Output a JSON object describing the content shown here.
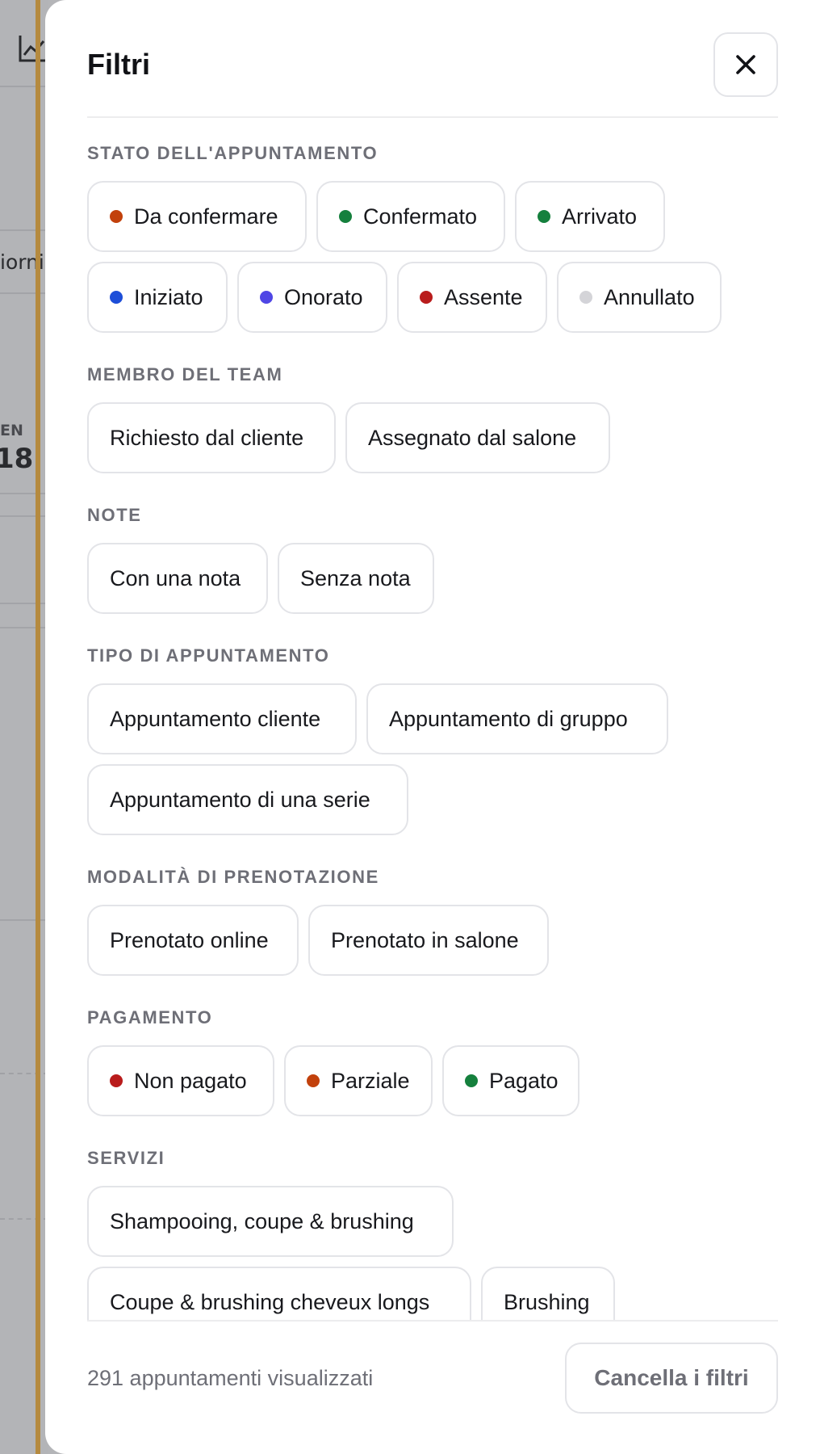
{
  "background": {
    "fragment_1": "iorni",
    "fragment_2": "EN",
    "fragment_3": "18"
  },
  "drawer": {
    "title": "Filtri",
    "close_icon": "close-icon"
  },
  "sections": {
    "status": {
      "label": "STATO DELL'APPUNTAMENTO",
      "chips": [
        {
          "label": "Da confermare",
          "color": "#c2410c"
        },
        {
          "label": "Confermato",
          "color": "#15803d"
        },
        {
          "label": "Arrivato",
          "color": "#15803d"
        },
        {
          "label": "Iniziato",
          "color": "#1d4ed8"
        },
        {
          "label": "Onorato",
          "color": "#4f46e5"
        },
        {
          "label": "Assente",
          "color": "#b91c1c"
        },
        {
          "label": "Annullato",
          "color": "#d4d4d8"
        }
      ]
    },
    "team": {
      "label": "MEMBRO DEL TEAM",
      "chips": [
        {
          "label": "Richiesto dal cliente"
        },
        {
          "label": "Assegnato dal salone"
        }
      ]
    },
    "note": {
      "label": "NOTE",
      "chips": [
        {
          "label": "Con una nota"
        },
        {
          "label": "Senza nota"
        }
      ]
    },
    "type": {
      "label": "TIPO DI APPUNTAMENTO",
      "chips": [
        {
          "label": "Appuntamento cliente"
        },
        {
          "label": "Appuntamento di gruppo"
        },
        {
          "label": "Appuntamento di una serie"
        }
      ]
    },
    "booking": {
      "label": "MODALITÀ DI PRENOTAZIONE",
      "chips": [
        {
          "label": "Prenotato online"
        },
        {
          "label": "Prenotato in salone"
        }
      ]
    },
    "payment": {
      "label": "PAGAMENTO",
      "chips": [
        {
          "label": "Non pagato",
          "color": "#b91c1c"
        },
        {
          "label": "Parziale",
          "color": "#c2410c"
        },
        {
          "label": "Pagato",
          "color": "#15803d"
        }
      ]
    },
    "services": {
      "label": "SERVIZI",
      "chips": [
        {
          "label": "Shampooing, coupe & brushing"
        },
        {
          "label": "Coupe & brushing cheveux longs"
        },
        {
          "label": "Brushing"
        }
      ]
    }
  },
  "footer": {
    "count_text": "291 appuntamenti visualizzati",
    "clear_label": "Cancella i filtri"
  }
}
